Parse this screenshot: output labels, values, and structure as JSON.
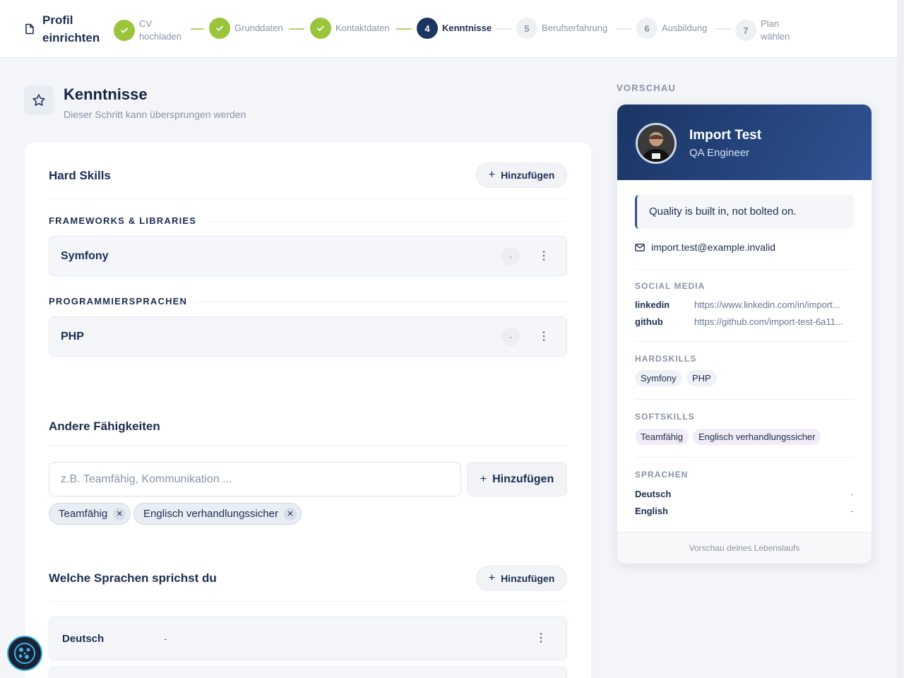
{
  "header": {
    "title": "Profil einrichten",
    "steps": [
      {
        "num": "",
        "label": "CV hochladen",
        "state": "done"
      },
      {
        "num": "",
        "label": "Grunddaten",
        "state": "done"
      },
      {
        "num": "",
        "label": "Kontaktdaten",
        "state": "done"
      },
      {
        "num": "4",
        "label": "Kenntnisse",
        "state": "active"
      },
      {
        "num": "5",
        "label": "Berufserfahrung",
        "state": "todo"
      },
      {
        "num": "6",
        "label": "Ausbildung",
        "state": "todo"
      },
      {
        "num": "7",
        "label": "Plan wählen",
        "state": "todo"
      }
    ]
  },
  "page": {
    "title": "Kenntnisse",
    "subtitle": "Dieser Schritt kann übersprungen werden"
  },
  "hard_skills": {
    "title": "Hard Skills",
    "add_label": "Hinzufügen",
    "categories": [
      {
        "name": "FRAMEWORKS & LIBRARIES",
        "skills": [
          {
            "name": "Symfony",
            "level": "-"
          }
        ]
      },
      {
        "name": "PROGRAMMIERSPRACHEN",
        "skills": [
          {
            "name": "PHP",
            "level": "-"
          }
        ]
      }
    ]
  },
  "other_skills": {
    "title": "Andere Fähigkeiten",
    "placeholder": "z.B. Teamfähig, Kommunikation ...",
    "add_label": "Hinzufügen",
    "chips": [
      "Teamfähig",
      "Englisch verhandlungssicher"
    ]
  },
  "languages": {
    "title": "Welche Sprachen sprichst du",
    "add_label": "Hinzufügen",
    "items": [
      {
        "name": "Deutsch",
        "level": "-"
      }
    ]
  },
  "preview": {
    "label": "VORSCHAU",
    "name": "Import Test",
    "role": "QA Engineer",
    "quote": "Quality is built in, not bolted on.",
    "email": "import.test@example.invalid",
    "social_title": "SOCIAL MEDIA",
    "social": [
      {
        "k": "linkedin",
        "v": "https://www.linkedin.com/in/import..."
      },
      {
        "k": "github",
        "v": "https://github.com/import-test-6a11..."
      }
    ],
    "hard_title": "HARDSKILLS",
    "hard": [
      "Symfony",
      "PHP"
    ],
    "soft_title": "SOFTSKILLS",
    "soft": [
      "Teamfähig",
      "Englisch verhandlungssicher"
    ],
    "lang_title": "SPRACHEN",
    "langs": [
      {
        "k": "Deutsch",
        "v": "-"
      },
      {
        "k": "English",
        "v": "-"
      }
    ],
    "footer": "Vorschau deines Lebenslaufs"
  },
  "colors": {
    "accent": "#1b3563",
    "done": "#9ac43c"
  }
}
